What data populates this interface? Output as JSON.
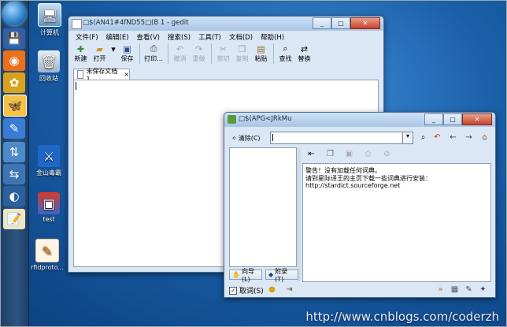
{
  "desktop": {
    "icons": [
      {
        "label": "计算机",
        "icon": "computer-icon"
      },
      {
        "label": "回收站",
        "icon": "recycle-bin-icon"
      },
      {
        "label": "金山毒霸",
        "icon": "antivirus-icon"
      },
      {
        "label": "test",
        "icon": "app-icon"
      },
      {
        "label": "rfidproto...",
        "icon": "pdf-icon"
      }
    ],
    "watermark": "http://www.cnblogs.com/coderzh"
  },
  "taskbar": {
    "items": [
      "start-orb",
      "floppy",
      "firefox",
      "app",
      "butterfly",
      "pen",
      "network",
      "transfer",
      "circle",
      "notes"
    ]
  },
  "gedit": {
    "title": "□$(AN41#4fND55□(B 1 - gedit",
    "menus": [
      "文件(F)",
      "编辑(E)",
      "查看(V)",
      "搜索(S)",
      "工具(T)",
      "文档(D)",
      "帮助(H)"
    ],
    "toolbar": [
      {
        "label": "新建",
        "glyph": "📄",
        "enabled": true
      },
      {
        "label": "打开",
        "glyph": "📂",
        "enabled": true
      },
      {
        "label": "▾",
        "glyph": "",
        "enabled": true
      },
      {
        "label": "保存",
        "glyph": "💾",
        "enabled": true
      },
      {
        "label": "打印...",
        "glyph": "🖨",
        "enabled": true
      },
      {
        "label": "撤消",
        "glyph": "↶",
        "enabled": false
      },
      {
        "label": "重做",
        "glyph": "↷",
        "enabled": false
      },
      {
        "label": "剪切",
        "glyph": "✂",
        "enabled": false
      },
      {
        "label": "复制",
        "glyph": "⎘",
        "enabled": false
      },
      {
        "label": "粘贴",
        "glyph": "📋",
        "enabled": true
      },
      {
        "label": "查找",
        "glyph": "🔍",
        "enabled": true
      },
      {
        "label": "替换",
        "glyph": "⇄",
        "enabled": true
      }
    ],
    "tab_label": "未保存文档 1",
    "tab_close": "×"
  },
  "stardict": {
    "title": "□$(APG<JRkMu",
    "clear_label": "清除(C)",
    "search_value": "",
    "nav_icons": [
      "find-icon",
      "back-icon",
      "prev-icon",
      "next-icon",
      "home-icon"
    ],
    "mid_icons": [
      "jump-icon",
      "copy-icon",
      "save-icon",
      "print-icon",
      "clear-icon"
    ],
    "definition_lines": [
      "警告！没有加载任何词典。",
      "请到星际译王的主页下载一些词典进行安装：",
      "http://stardict.sourceforge.net"
    ],
    "guide_button": "向导(L)",
    "appendix_button": "附录(T)",
    "scan_label": "取词(S)",
    "scan_checked": true
  }
}
